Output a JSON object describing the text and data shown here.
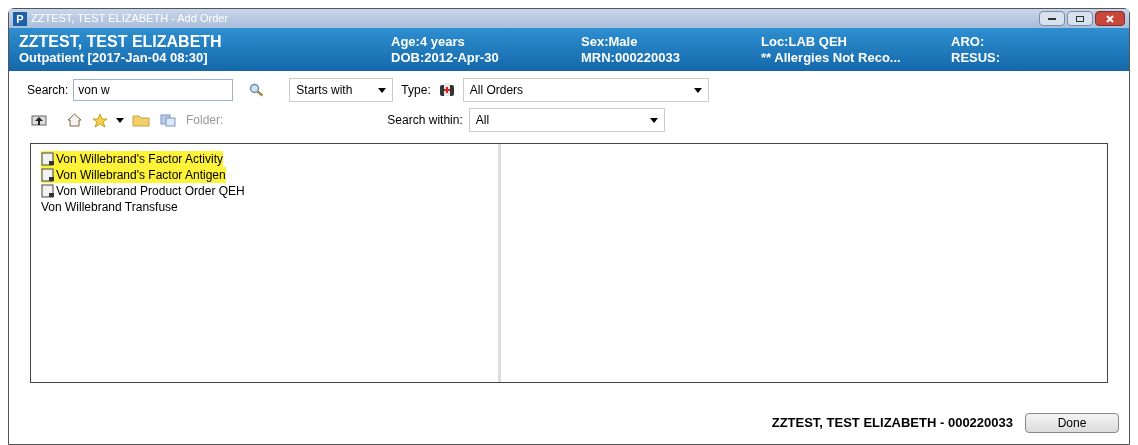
{
  "window": {
    "title": "ZZTEST, TEST ELIZABETH - Add Order",
    "app_letter": "P"
  },
  "banner": {
    "columns": [
      [
        "ZZTEST, TEST ELIZABETH",
        "Outpatient [2017-Jan-04 08:30]"
      ],
      [
        "Age:4 years",
        "DOB:2012-Apr-30"
      ],
      [
        "Sex:Male",
        "MRN:000220033"
      ],
      [
        "Loc:LAB QEH",
        "** Allergies Not Reco..."
      ],
      [
        "ARO:",
        "RESUS:"
      ]
    ]
  },
  "search": {
    "label": "Search:",
    "value": "von w",
    "mode": "Starts with",
    "type_label": "Type:",
    "type_value": "All Orders"
  },
  "toolbar": {
    "folder_label": "Folder:",
    "within_label": "Search within:",
    "within_value": "All"
  },
  "results": [
    {
      "label": "Von Willebrand's Factor Activity",
      "kind": "order",
      "highlighted": true
    },
    {
      "label": "Von Willebrand's Factor Antigen",
      "kind": "order",
      "highlighted": true
    },
    {
      "label": "Von Willebrand Product Order QEH",
      "kind": "order",
      "highlighted": false
    },
    {
      "label": "Von Willebrand Transfuse",
      "kind": "plain",
      "highlighted": false
    }
  ],
  "footer": {
    "patient": "ZZTEST, TEST ELIZABETH - 000220033",
    "button": "Done"
  }
}
